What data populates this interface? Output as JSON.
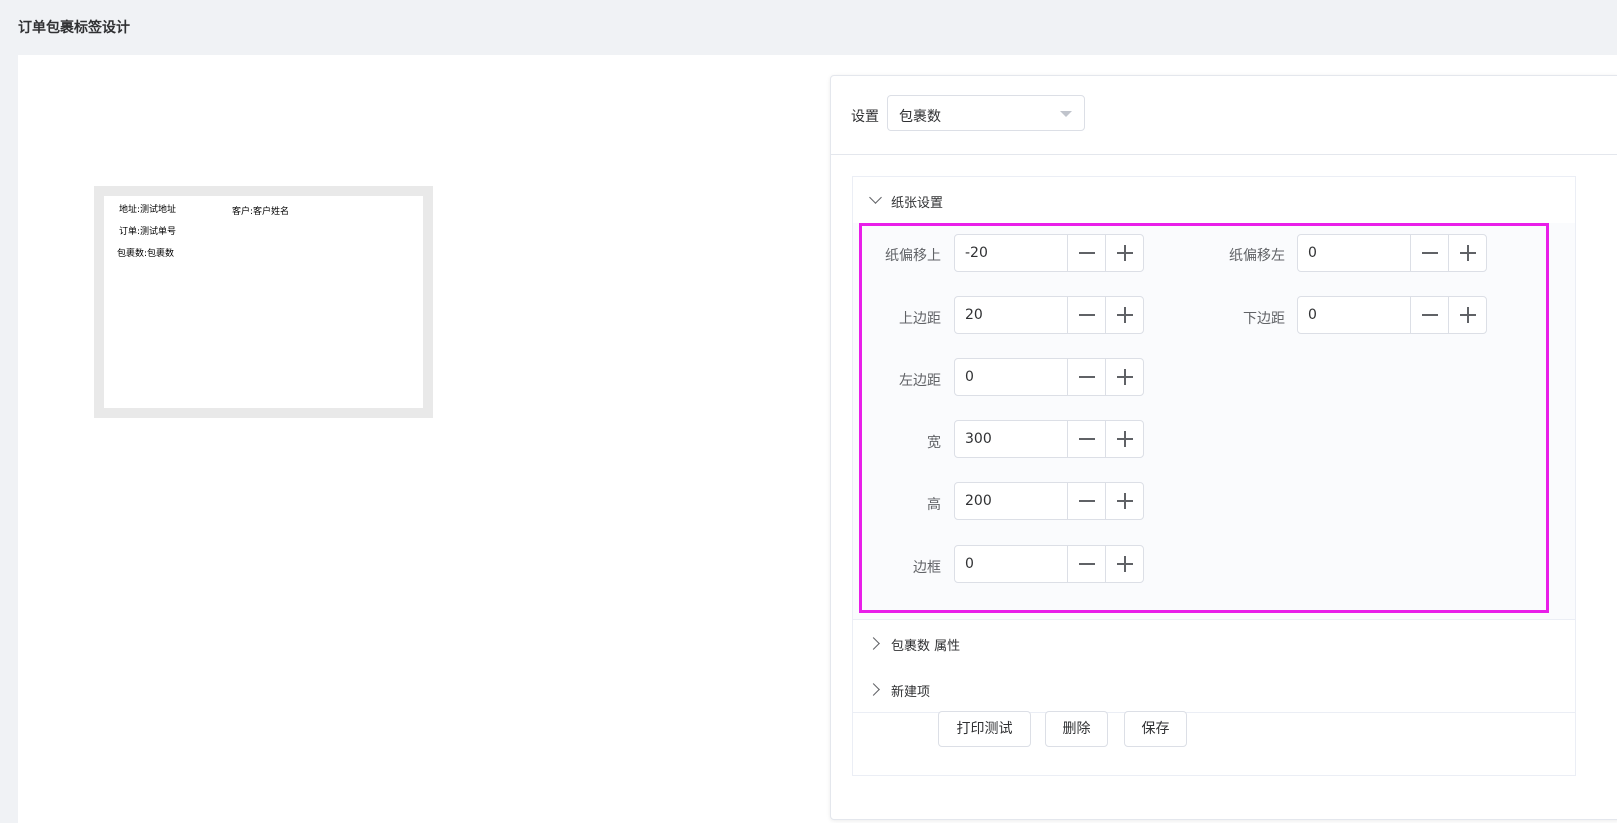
{
  "page": {
    "title": "订单包裹标签设计"
  },
  "preview": {
    "address": "地址:测试地址",
    "customer": "客户:客户姓名",
    "order": "订单:测试单号",
    "package_count": "包裹数:包裹数"
  },
  "settings": {
    "label": "设置",
    "select_value": "包裹数"
  },
  "paper_section": {
    "title": "纸张设置",
    "fields": {
      "offset_top": {
        "label": "纸偏移上",
        "value": "-20"
      },
      "offset_left": {
        "label": "纸偏移左",
        "value": "0"
      },
      "margin_top": {
        "label": "上边距",
        "value": "20"
      },
      "margin_bottom": {
        "label": "下边距",
        "value": "0"
      },
      "margin_left": {
        "label": "左边距",
        "value": "0"
      },
      "width": {
        "label": "宽",
        "value": "300"
      },
      "height": {
        "label": "高",
        "value": "200"
      },
      "border": {
        "label": "边框",
        "value": "0"
      }
    }
  },
  "collapse_items": {
    "package_props": "包裹数 属性",
    "new_item": "新建项"
  },
  "buttons": {
    "print_test": "打印测试",
    "delete": "删除",
    "save": "保存"
  },
  "icons": {
    "stepper_minus": "minus-icon",
    "stepper_plus": "plus-icon",
    "select_caret": "caret-down-icon",
    "expand": "chevron-down-icon",
    "collapsed": "chevron-right-icon"
  },
  "colors": {
    "highlight": "#e91ee9",
    "background": "#f0f2f5"
  }
}
